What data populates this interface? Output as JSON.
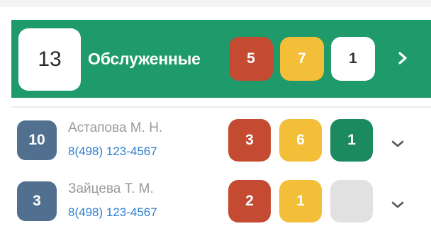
{
  "summary": {
    "count": "13",
    "title": "Обслуженные",
    "badges": [
      "5",
      "7",
      "1"
    ]
  },
  "rows": [
    {
      "count": "10",
      "name": "Астапова М. Н.",
      "phone": "8(498) 123-4567",
      "badges": [
        "3",
        "6",
        "1"
      ]
    },
    {
      "count": "3",
      "name": "Зайцева Т. М.",
      "phone": "8(498) 123-4567",
      "badges": [
        "2",
        "1",
        ""
      ]
    }
  ],
  "colors": {
    "banner": "#1f9a6b",
    "red": "#c44a32",
    "yellow": "#f3be38",
    "green": "#1c8a5f",
    "slate": "#51708f",
    "link": "#2f7fd0"
  },
  "icons": {
    "expand": "chevron-right-icon",
    "row_expand": "chevron-down-icon"
  }
}
